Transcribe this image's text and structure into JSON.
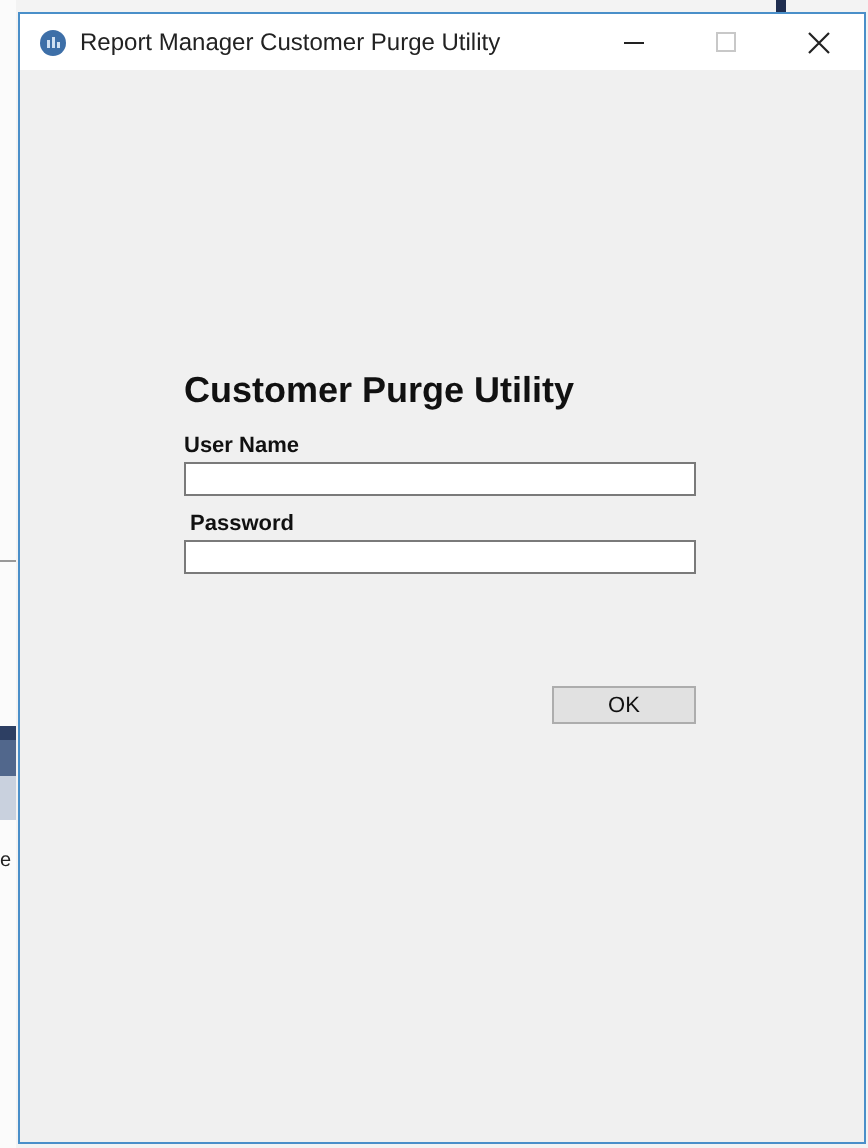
{
  "background": {
    "text": "e"
  },
  "window": {
    "title": "Report Manager Customer Purge Utility"
  },
  "form": {
    "heading": "Customer Purge Utility",
    "fields": [
      {
        "label": "User Name"
      },
      {
        "label": "Password"
      }
    ],
    "buttons": [
      "OK"
    ]
  }
}
